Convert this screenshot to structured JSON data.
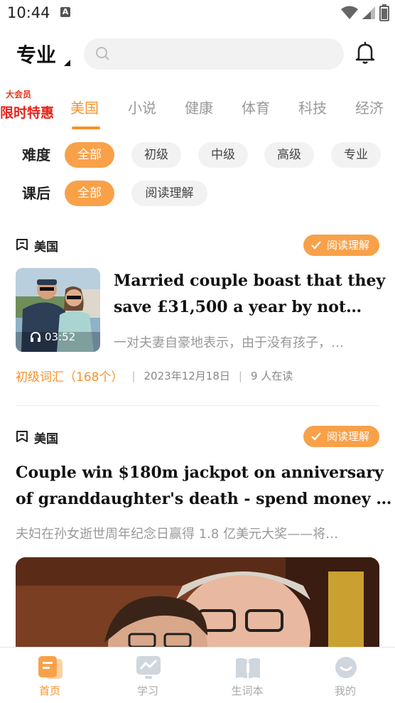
{
  "status_bar": {
    "time": "10:44",
    "app_icon_letter": "A"
  },
  "header": {
    "level": "专业",
    "search_placeholder": ""
  },
  "promo": {
    "top_text": "大会员",
    "main_text": "限时特惠"
  },
  "tabs": [
    "美国",
    "小说",
    "健康",
    "体育",
    "科技",
    "经济"
  ],
  "filters": {
    "difficulty": {
      "label": "难度",
      "options": [
        "全部",
        "初级",
        "中级",
        "高级",
        "专业"
      ]
    },
    "after_class": {
      "label": "课后",
      "options": [
        "全部",
        "阅读理解"
      ]
    }
  },
  "articles": [
    {
      "category": "美国",
      "badge": "阅读理解",
      "title_line1": "Married couple boast that they",
      "title_line2": "save £31,500 a year by not…",
      "summary": "一对夫妻自豪地表示，由于没有孩子，…",
      "duration": "03:52",
      "vocab": "初级词汇（168个）",
      "date": "2023年12月18日",
      "readers": "9 人在读"
    },
    {
      "category": "美国",
      "badge": "阅读理解",
      "title_line1": "Couple win $180m jackpot on anniversary",
      "title_line2": "of granddaughter's death - spend money …",
      "summary": "夫妇在孙女逝世周年纪念日赢得 1.8 亿美元大奖——将…"
    }
  ],
  "bottom_nav": [
    "首页",
    "学习",
    "生词本",
    "我的"
  ],
  "colors": {
    "accent": "#f7922a",
    "chip_active": "#f8a149",
    "promo_red": "#e8231b"
  }
}
